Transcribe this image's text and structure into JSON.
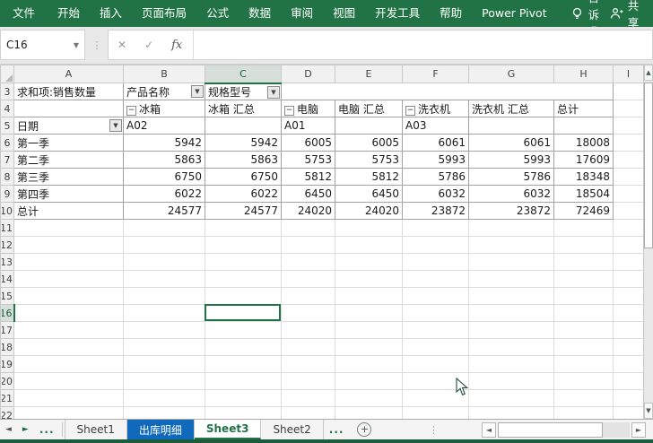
{
  "ribbon": {
    "tabs": [
      "文件",
      "开始",
      "插入",
      "页面布局",
      "公式",
      "数据",
      "审阅",
      "视图",
      "开发工具",
      "帮助",
      "Power Pivot"
    ],
    "tell_me": "告诉我",
    "share": "共享"
  },
  "formula_bar": {
    "name_box": "C16",
    "formula": ""
  },
  "icons": {
    "dropdown": "▼",
    "filter": "▼",
    "collapse": "−",
    "cancel": "✕",
    "enter": "✓",
    "fx": "fx",
    "vdots": "⋮",
    "more": "...",
    "add": "+",
    "left": "◄",
    "right": "►",
    "up": "▲",
    "down": "▼"
  },
  "grid": {
    "columns": [
      "A",
      "B",
      "C",
      "D",
      "E",
      "F",
      "G",
      "H",
      "I"
    ],
    "first_row": 3,
    "last_row": 22,
    "active_cell": "C16"
  },
  "pivot": {
    "title": "求和项:销售数量",
    "field_product": "产品名称",
    "field_spec": "规格型号",
    "field_date": "日期",
    "col_headers": [
      "冰箱",
      "冰箱 汇总",
      "电脑",
      "电脑 汇总",
      "洗衣机",
      "洗衣机 汇总",
      "总计"
    ],
    "collapsible": [
      0,
      2,
      4
    ],
    "spec_row": [
      "A02",
      "",
      "A01",
      "",
      "A03",
      "",
      ""
    ],
    "rows": [
      {
        "label": "第一季",
        "values": [
          5942,
          5942,
          6005,
          6005,
          6061,
          6061,
          18008
        ]
      },
      {
        "label": "第二季",
        "values": [
          5863,
          5863,
          5753,
          5753,
          5993,
          5993,
          17609
        ]
      },
      {
        "label": "第三季",
        "values": [
          6750,
          6750,
          5812,
          5812,
          5786,
          5786,
          18348
        ]
      },
      {
        "label": "第四季",
        "values": [
          6022,
          6022,
          6450,
          6450,
          6032,
          6032,
          18504
        ]
      },
      {
        "label": "总计",
        "values": [
          24577,
          24577,
          24020,
          24020,
          23872,
          23872,
          72469
        ]
      }
    ]
  },
  "sheet_tabs": {
    "tabs": [
      {
        "label": "Sheet1",
        "state": "normal"
      },
      {
        "label": "出库明细",
        "state": "colored"
      },
      {
        "label": "Sheet3",
        "state": "active"
      },
      {
        "label": "Sheet2",
        "state": "normal"
      }
    ]
  },
  "colors": {
    "ribbon_green": "#217346",
    "sheet_tab_blue": "#1169BC",
    "selection_green": "#217346",
    "colored_tab_text": "#FFFFFF"
  }
}
